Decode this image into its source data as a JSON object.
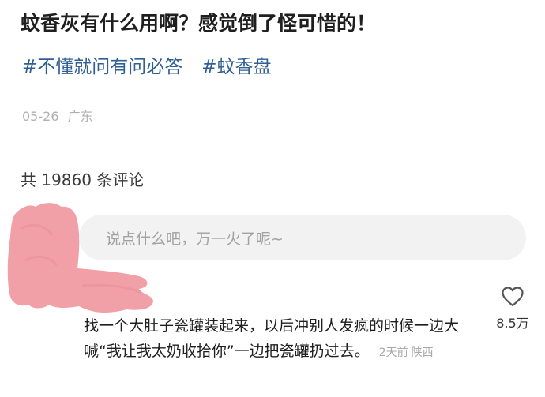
{
  "post": {
    "title": "蚊香灰有什么用啊？感觉倒了怪可惜的！",
    "tags": [
      "#不懂就问有问必答",
      "#蚊香盘"
    ],
    "date": "05-26",
    "location": "广东"
  },
  "comments": {
    "count_text": "共 19860 条评论",
    "input_placeholder": "说点什么吧，万一火了呢~"
  },
  "top_comment": {
    "text": "找一个大肚子瓷罐装起来，以后冲别人发疯的时候一边大喊“我让我太奶收拾你”一边把瓷罐扔过去。",
    "time": "2天前",
    "location": "陕西",
    "likes": "8.5万",
    "like_icon": "heart-outline-icon"
  },
  "colors": {
    "tag": "#2f5f93",
    "redaction": "#f1a0a8",
    "meta": "#b0b0b0"
  }
}
